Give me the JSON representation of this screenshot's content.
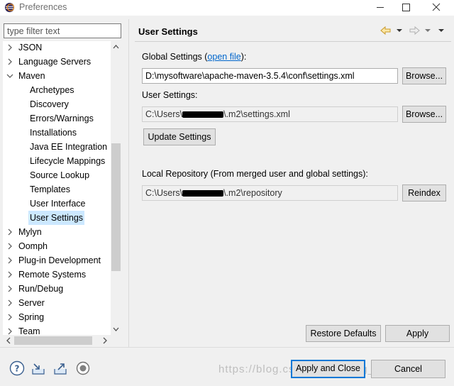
{
  "window": {
    "title": "Preferences"
  },
  "filter": {
    "placeholder": "type filter text"
  },
  "tree": {
    "items": [
      {
        "label": "JSON",
        "level": 0,
        "twisty": "collapsed"
      },
      {
        "label": "Language Servers",
        "level": 0,
        "twisty": "collapsed"
      },
      {
        "label": "Maven",
        "level": 0,
        "twisty": "expanded"
      },
      {
        "label": "Archetypes",
        "level": 1
      },
      {
        "label": "Discovery",
        "level": 1
      },
      {
        "label": "Errors/Warnings",
        "level": 1
      },
      {
        "label": "Installations",
        "level": 1
      },
      {
        "label": "Java EE Integration",
        "level": 1
      },
      {
        "label": "Lifecycle Mappings",
        "level": 1
      },
      {
        "label": "Source Lookup",
        "level": 1
      },
      {
        "label": "Templates",
        "level": 1
      },
      {
        "label": "User Interface",
        "level": 1
      },
      {
        "label": "User Settings",
        "level": 1,
        "selected": true
      },
      {
        "label": "Mylyn",
        "level": 0,
        "twisty": "collapsed"
      },
      {
        "label": "Oomph",
        "level": 0,
        "twisty": "collapsed"
      },
      {
        "label": "Plug-in Development",
        "level": 0,
        "twisty": "collapsed"
      },
      {
        "label": "Remote Systems",
        "level": 0,
        "twisty": "collapsed"
      },
      {
        "label": "Run/Debug",
        "level": 0,
        "twisty": "collapsed"
      },
      {
        "label": "Server",
        "level": 0,
        "twisty": "collapsed"
      },
      {
        "label": "Spring",
        "level": 0,
        "twisty": "collapsed"
      },
      {
        "label": "Team",
        "level": 0,
        "twisty": "collapsed"
      }
    ]
  },
  "page": {
    "title": "User Settings",
    "global_label_prefix": "Global Settings (",
    "global_link": "open file",
    "global_label_suffix": "):",
    "global_value": "D:\\mysoftware\\apache-maven-3.5.4\\conf\\settings.xml",
    "browse_label": "Browse...",
    "user_label": "User Settings:",
    "user_value_prefix": "C:\\Users\\",
    "user_value_suffix": "\\.m2\\settings.xml",
    "update_label": "Update Settings",
    "local_label": "Local Repository (From merged user and global settings):",
    "local_value_prefix": "C:\\Users\\",
    "local_value_suffix": "\\.m2\\repository",
    "reindex_label": "Reindex",
    "restore_label": "Restore Defaults",
    "apply_label": "Apply"
  },
  "footer": {
    "apply_close_label": "Apply and Close",
    "cancel_label": "Cancel",
    "watermark": "https://blog.csdn.net/coding_lin"
  },
  "colors": {
    "selection": "#cce8ff",
    "link": "#0066cc",
    "default_button_border": "#0078d7"
  },
  "icons": [
    "eclipse-icon",
    "back-arrow-icon",
    "forward-arrow-icon",
    "help-icon",
    "import-icon",
    "export-icon",
    "record-icon"
  ]
}
